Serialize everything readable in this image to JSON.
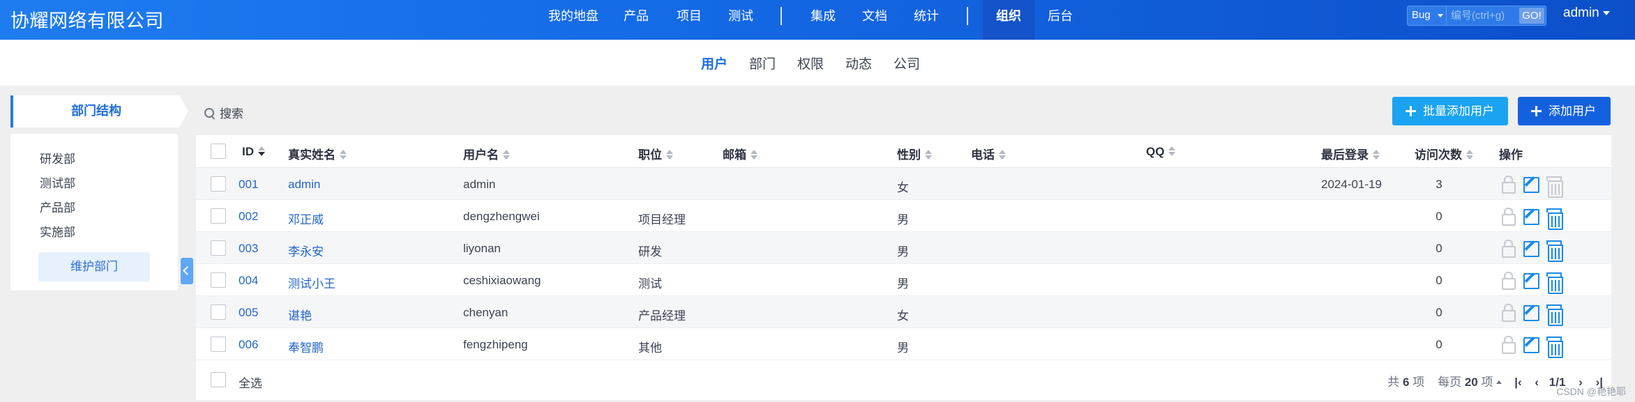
{
  "header": {
    "brand": "协耀网络有限公司",
    "nav": [
      "我的地盘",
      "产品",
      "项目",
      "测试",
      "集成",
      "文档",
      "统计",
      "组织",
      "后台"
    ],
    "active_nav": "组织",
    "search": {
      "type": "Bug",
      "placeholder": "编号(ctrl+g)",
      "go_label": "GO!"
    },
    "user": "admin"
  },
  "subnav": {
    "items": [
      "用户",
      "部门",
      "权限",
      "动态",
      "公司"
    ],
    "active": "用户"
  },
  "sidebar": {
    "tab_label": "部门结构",
    "departments": [
      "研发部",
      "测试部",
      "产品部",
      "实施部"
    ],
    "maintain_button": "维护部门"
  },
  "toolbar": {
    "search_label": "搜索",
    "batch_add_label": "批量添加用户",
    "add_label": "添加用户"
  },
  "table": {
    "columns": [
      "ID",
      "真实姓名",
      "用户名",
      "职位",
      "邮箱",
      "性别",
      "电话",
      "QQ",
      "最后登录",
      "访问次数",
      "操作"
    ],
    "rows": [
      {
        "id": "001",
        "realname": "admin",
        "account": "admin",
        "role": "",
        "email": "",
        "gender": "女",
        "phone": "",
        "qq": "",
        "last_login": "2024-01-19",
        "visits": "3"
      },
      {
        "id": "002",
        "realname": "邓正威",
        "account": "dengzhengwei",
        "role": "项目经理",
        "email": "",
        "gender": "男",
        "phone": "",
        "qq": "",
        "last_login": "",
        "visits": "0"
      },
      {
        "id": "003",
        "realname": "李永安",
        "account": "liyonan",
        "role": "研发",
        "email": "",
        "gender": "男",
        "phone": "",
        "qq": "",
        "last_login": "",
        "visits": "0"
      },
      {
        "id": "004",
        "realname": "测试小王",
        "account": "ceshixiaowang",
        "role": "测试",
        "email": "",
        "gender": "男",
        "phone": "",
        "qq": "",
        "last_login": "",
        "visits": "0"
      },
      {
        "id": "005",
        "realname": "谌艳",
        "account": "chenyan",
        "role": "产品经理",
        "email": "",
        "gender": "女",
        "phone": "",
        "qq": "",
        "last_login": "",
        "visits": "0"
      },
      {
        "id": "006",
        "realname": "奉智鹏",
        "account": "fengzhipeng",
        "role": "其他",
        "email": "",
        "gender": "男",
        "phone": "",
        "qq": "",
        "last_login": "",
        "visits": "0"
      }
    ]
  },
  "footer": {
    "select_all": "全选",
    "total_prefix": "共",
    "total": "6",
    "total_suffix": "项",
    "per_page_prefix": "每页",
    "per_page": "20",
    "per_page_suffix": "项",
    "page": "1/1"
  },
  "watermark": "CSDN @艳艳耶"
}
